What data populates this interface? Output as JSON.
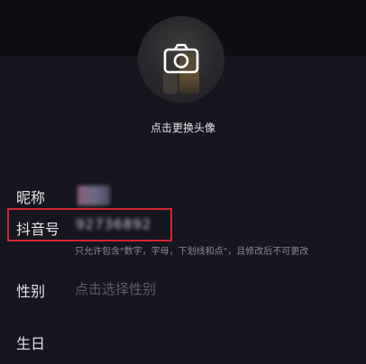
{
  "profile": {
    "change_avatar_label": "点击更换头像",
    "camera_icon": "camera-icon"
  },
  "fields": {
    "nickname": {
      "label": "昵称",
      "value": ""
    },
    "douyin_id": {
      "label": "抖音号",
      "value": "92736892",
      "hint": "只允许包含\"数字，字母，下划线和点\"，且修改后不可更改"
    },
    "gender": {
      "label": "性别",
      "placeholder": "点击选择性别"
    },
    "birthday": {
      "label": "生日"
    }
  },
  "highlight": {
    "color": "#d32630"
  }
}
